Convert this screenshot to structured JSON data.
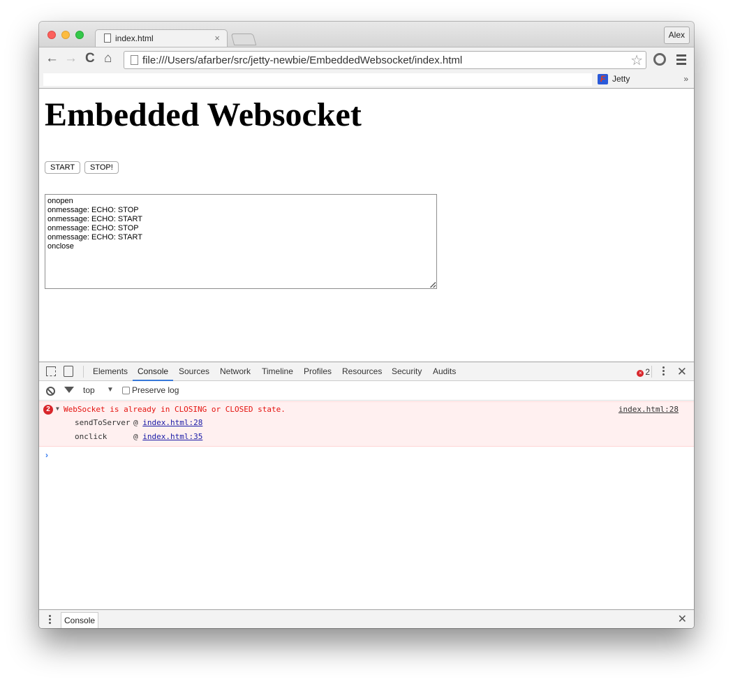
{
  "browser": {
    "tab_title": "index.html",
    "tab_close": "×",
    "profile_name": "Alex",
    "url": "file:///Users/afarber/src/jetty-newbie/EmbeddedWebsocket/index.html",
    "nav": {
      "back": "←",
      "forward": "→",
      "reload": "C",
      "home": "⌂"
    },
    "star_glyph": "☆",
    "bookmarks": [
      {
        "label": "Jetty",
        "icon_glyph": "F"
      }
    ],
    "bookmarks_more": "»"
  },
  "page": {
    "heading": "Embedded Websocket",
    "buttons": {
      "start": "START",
      "stop": "STOP!"
    },
    "log_lines": [
      "onopen",
      "onmessage: ECHO: STOP",
      "onmessage: ECHO: START",
      "onmessage: ECHO: STOP",
      "onmessage: ECHO: START",
      "onclose"
    ]
  },
  "devtools": {
    "tabs": [
      "Elements",
      "Console",
      "Sources",
      "Network",
      "Timeline",
      "Profiles",
      "Resources",
      "Security",
      "Audits"
    ],
    "active_tab": "Console",
    "error_count": "2",
    "close_glyph": "✕",
    "console_toolbar": {
      "context": "top",
      "context_arrow": "▼",
      "preserve_log_label": "Preserve log",
      "preserve_log_checked": false
    },
    "messages": [
      {
        "level": "error",
        "repeat_count": "2",
        "expanded_glyph": "▼",
        "text": "WebSocket is already in CLOSING or CLOSED state.",
        "source": "index.html:28",
        "stack": [
          {
            "function": "sendToServer",
            "at": "@",
            "link": "index.html:28"
          },
          {
            "function": "onclick",
            "at": "@",
            "link": "index.html:35"
          }
        ]
      }
    ],
    "prompt_glyph": "›",
    "drawer": {
      "tab_label": "Console",
      "close_glyph": "✕"
    }
  },
  "colors": {
    "error_text": "#e4120e",
    "error_bg": "#fff0f0",
    "link": "#1a1aa6",
    "active_tab_underline": "#3879d9"
  }
}
